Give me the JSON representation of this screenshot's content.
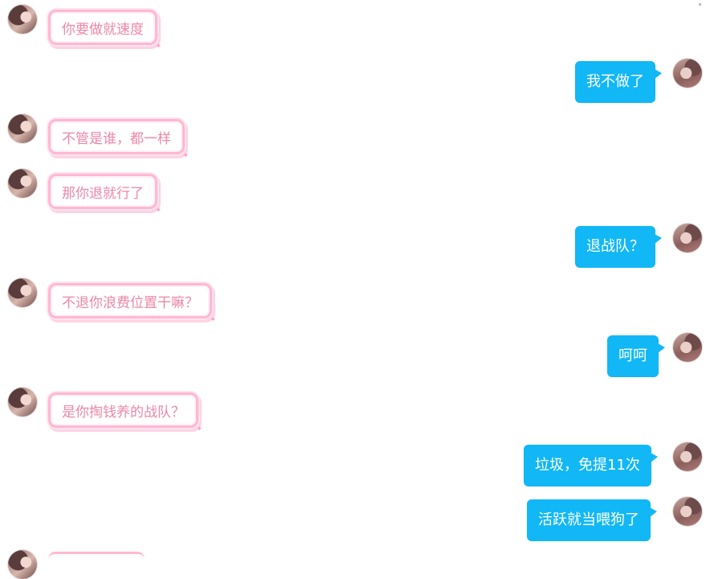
{
  "messages": [
    {
      "side": "left",
      "text": "你要做就速度"
    },
    {
      "side": "right",
      "text": "我不做了"
    },
    {
      "side": "left",
      "text": "不管是谁，都一样"
    },
    {
      "side": "left",
      "text": "那你退就行了"
    },
    {
      "side": "right",
      "text": "退战队？"
    },
    {
      "side": "left",
      "text": "不退你浪费位置干嘛？"
    },
    {
      "side": "right",
      "text": "呵呵"
    },
    {
      "side": "left",
      "text": "是你掏钱养的战队？"
    },
    {
      "side": "right",
      "text": "垃圾，免提11次"
    },
    {
      "side": "right",
      "text": "活跃就当喂狗了"
    }
  ],
  "colors": {
    "incoming_text": "#ee86a6",
    "incoming_border": "#ffb7d2",
    "outgoing_bubble": "#12b7f5"
  }
}
